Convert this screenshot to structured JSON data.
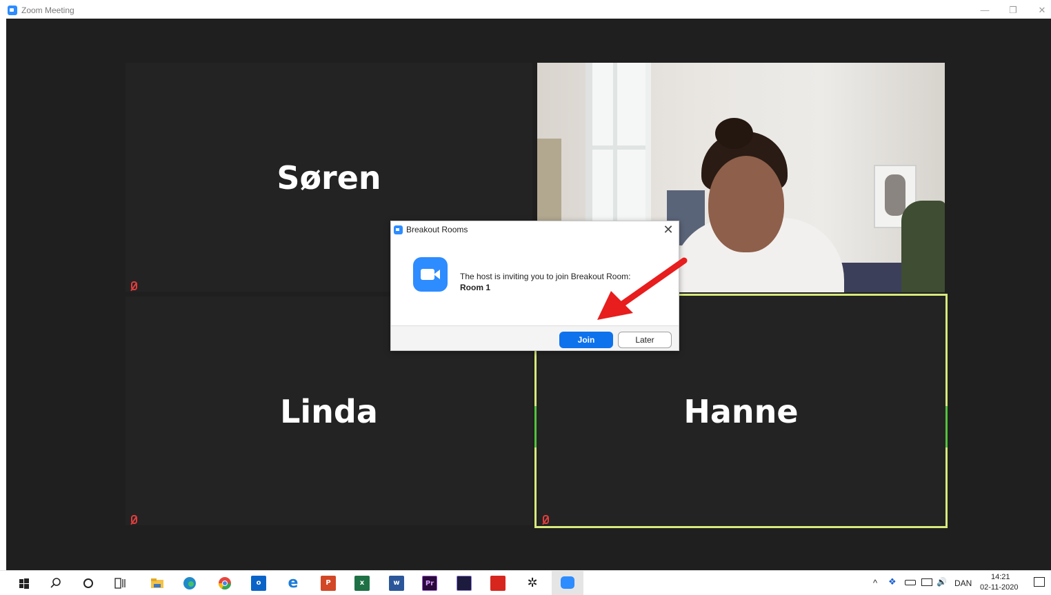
{
  "window": {
    "title": "Zoom Meeting",
    "controls": {
      "minimize": "—",
      "restore": "❐",
      "close": "✕"
    }
  },
  "participants": {
    "soren": "Søren",
    "linda": "Linda",
    "hanne": "Hanne"
  },
  "dialog": {
    "title": "Breakout Rooms",
    "close": "✕",
    "message": "The host is inviting you to join Breakout Room:",
    "room": "Room 1",
    "join_label": "Join",
    "later_label": "Later"
  },
  "taskbar": {
    "icons": [
      "windows-start-icon",
      "search-icon",
      "cortana-icon",
      "task-view-icon",
      "file-explorer-icon",
      "edge-icon",
      "chrome-icon",
      "outlook-icon",
      "internet-explorer-icon",
      "powerpoint-icon",
      "excel-icon",
      "word-icon",
      "premiere-icon",
      "media-encoder-icon",
      "acrobat-icon",
      "settings-icon",
      "zoom-icon"
    ],
    "outlook_label": "o",
    "powerpoint_label": "P",
    "excel_label": "x",
    "word_label": "w",
    "premiere_label": "Pr",
    "chevron": "^",
    "volume": "🔊",
    "language": "DAN",
    "time": "14:21",
    "date": "02-11-2020"
  },
  "colors": {
    "zoom_blue": "#2d8cff",
    "join_blue": "#0e72ed",
    "active_speaker": "#d8ea7c",
    "arrow_red": "#e81d1d",
    "mute_red": "#e23d3d"
  }
}
